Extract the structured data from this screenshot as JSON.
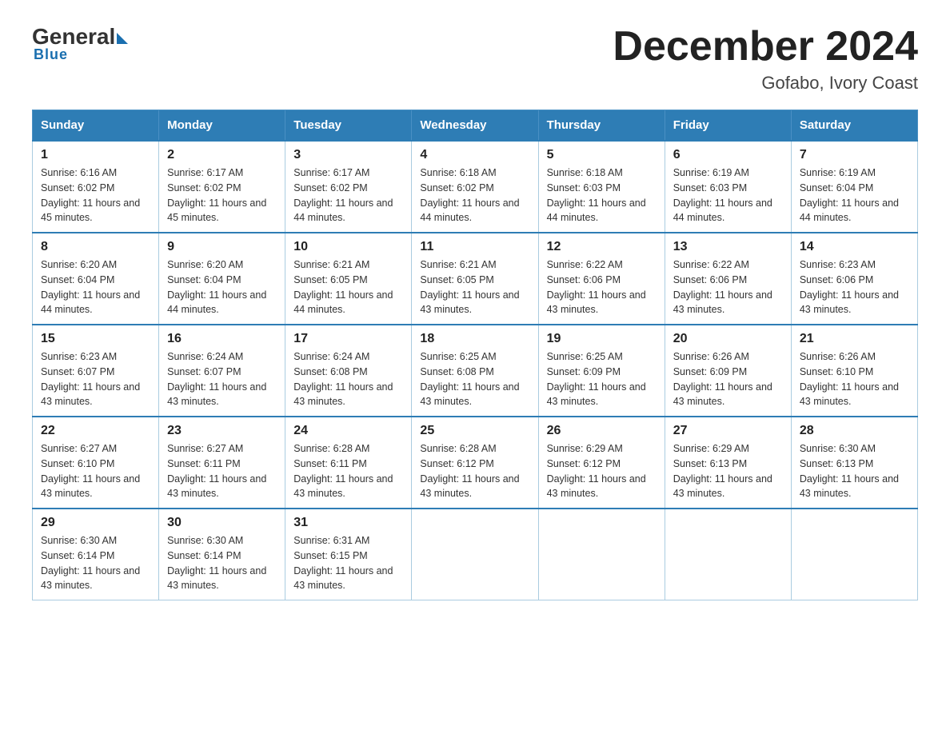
{
  "logo": {
    "general": "General",
    "blue": "Blue",
    "underline": "Blue"
  },
  "title": "December 2024",
  "subtitle": "Gofabo, Ivory Coast",
  "headers": [
    "Sunday",
    "Monday",
    "Tuesday",
    "Wednesday",
    "Thursday",
    "Friday",
    "Saturday"
  ],
  "weeks": [
    [
      {
        "day": "1",
        "sunrise": "Sunrise: 6:16 AM",
        "sunset": "Sunset: 6:02 PM",
        "daylight": "Daylight: 11 hours and 45 minutes."
      },
      {
        "day": "2",
        "sunrise": "Sunrise: 6:17 AM",
        "sunset": "Sunset: 6:02 PM",
        "daylight": "Daylight: 11 hours and 45 minutes."
      },
      {
        "day": "3",
        "sunrise": "Sunrise: 6:17 AM",
        "sunset": "Sunset: 6:02 PM",
        "daylight": "Daylight: 11 hours and 44 minutes."
      },
      {
        "day": "4",
        "sunrise": "Sunrise: 6:18 AM",
        "sunset": "Sunset: 6:02 PM",
        "daylight": "Daylight: 11 hours and 44 minutes."
      },
      {
        "day": "5",
        "sunrise": "Sunrise: 6:18 AM",
        "sunset": "Sunset: 6:03 PM",
        "daylight": "Daylight: 11 hours and 44 minutes."
      },
      {
        "day": "6",
        "sunrise": "Sunrise: 6:19 AM",
        "sunset": "Sunset: 6:03 PM",
        "daylight": "Daylight: 11 hours and 44 minutes."
      },
      {
        "day": "7",
        "sunrise": "Sunrise: 6:19 AM",
        "sunset": "Sunset: 6:04 PM",
        "daylight": "Daylight: 11 hours and 44 minutes."
      }
    ],
    [
      {
        "day": "8",
        "sunrise": "Sunrise: 6:20 AM",
        "sunset": "Sunset: 6:04 PM",
        "daylight": "Daylight: 11 hours and 44 minutes."
      },
      {
        "day": "9",
        "sunrise": "Sunrise: 6:20 AM",
        "sunset": "Sunset: 6:04 PM",
        "daylight": "Daylight: 11 hours and 44 minutes."
      },
      {
        "day": "10",
        "sunrise": "Sunrise: 6:21 AM",
        "sunset": "Sunset: 6:05 PM",
        "daylight": "Daylight: 11 hours and 44 minutes."
      },
      {
        "day": "11",
        "sunrise": "Sunrise: 6:21 AM",
        "sunset": "Sunset: 6:05 PM",
        "daylight": "Daylight: 11 hours and 43 minutes."
      },
      {
        "day": "12",
        "sunrise": "Sunrise: 6:22 AM",
        "sunset": "Sunset: 6:06 PM",
        "daylight": "Daylight: 11 hours and 43 minutes."
      },
      {
        "day": "13",
        "sunrise": "Sunrise: 6:22 AM",
        "sunset": "Sunset: 6:06 PM",
        "daylight": "Daylight: 11 hours and 43 minutes."
      },
      {
        "day": "14",
        "sunrise": "Sunrise: 6:23 AM",
        "sunset": "Sunset: 6:06 PM",
        "daylight": "Daylight: 11 hours and 43 minutes."
      }
    ],
    [
      {
        "day": "15",
        "sunrise": "Sunrise: 6:23 AM",
        "sunset": "Sunset: 6:07 PM",
        "daylight": "Daylight: 11 hours and 43 minutes."
      },
      {
        "day": "16",
        "sunrise": "Sunrise: 6:24 AM",
        "sunset": "Sunset: 6:07 PM",
        "daylight": "Daylight: 11 hours and 43 minutes."
      },
      {
        "day": "17",
        "sunrise": "Sunrise: 6:24 AM",
        "sunset": "Sunset: 6:08 PM",
        "daylight": "Daylight: 11 hours and 43 minutes."
      },
      {
        "day": "18",
        "sunrise": "Sunrise: 6:25 AM",
        "sunset": "Sunset: 6:08 PM",
        "daylight": "Daylight: 11 hours and 43 minutes."
      },
      {
        "day": "19",
        "sunrise": "Sunrise: 6:25 AM",
        "sunset": "Sunset: 6:09 PM",
        "daylight": "Daylight: 11 hours and 43 minutes."
      },
      {
        "day": "20",
        "sunrise": "Sunrise: 6:26 AM",
        "sunset": "Sunset: 6:09 PM",
        "daylight": "Daylight: 11 hours and 43 minutes."
      },
      {
        "day": "21",
        "sunrise": "Sunrise: 6:26 AM",
        "sunset": "Sunset: 6:10 PM",
        "daylight": "Daylight: 11 hours and 43 minutes."
      }
    ],
    [
      {
        "day": "22",
        "sunrise": "Sunrise: 6:27 AM",
        "sunset": "Sunset: 6:10 PM",
        "daylight": "Daylight: 11 hours and 43 minutes."
      },
      {
        "day": "23",
        "sunrise": "Sunrise: 6:27 AM",
        "sunset": "Sunset: 6:11 PM",
        "daylight": "Daylight: 11 hours and 43 minutes."
      },
      {
        "day": "24",
        "sunrise": "Sunrise: 6:28 AM",
        "sunset": "Sunset: 6:11 PM",
        "daylight": "Daylight: 11 hours and 43 minutes."
      },
      {
        "day": "25",
        "sunrise": "Sunrise: 6:28 AM",
        "sunset": "Sunset: 6:12 PM",
        "daylight": "Daylight: 11 hours and 43 minutes."
      },
      {
        "day": "26",
        "sunrise": "Sunrise: 6:29 AM",
        "sunset": "Sunset: 6:12 PM",
        "daylight": "Daylight: 11 hours and 43 minutes."
      },
      {
        "day": "27",
        "sunrise": "Sunrise: 6:29 AM",
        "sunset": "Sunset: 6:13 PM",
        "daylight": "Daylight: 11 hours and 43 minutes."
      },
      {
        "day": "28",
        "sunrise": "Sunrise: 6:30 AM",
        "sunset": "Sunset: 6:13 PM",
        "daylight": "Daylight: 11 hours and 43 minutes."
      }
    ],
    [
      {
        "day": "29",
        "sunrise": "Sunrise: 6:30 AM",
        "sunset": "Sunset: 6:14 PM",
        "daylight": "Daylight: 11 hours and 43 minutes."
      },
      {
        "day": "30",
        "sunrise": "Sunrise: 6:30 AM",
        "sunset": "Sunset: 6:14 PM",
        "daylight": "Daylight: 11 hours and 43 minutes."
      },
      {
        "day": "31",
        "sunrise": "Sunrise: 6:31 AM",
        "sunset": "Sunset: 6:15 PM",
        "daylight": "Daylight: 11 hours and 43 minutes."
      },
      null,
      null,
      null,
      null
    ]
  ]
}
